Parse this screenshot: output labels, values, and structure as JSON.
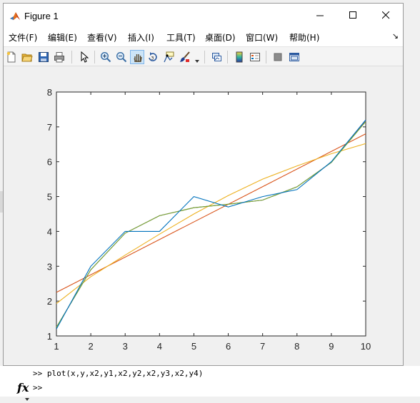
{
  "window": {
    "title": "Figure 1",
    "minimize_icon": "minimize-icon",
    "maximize_icon": "maximize-icon",
    "close_icon": "close-icon"
  },
  "menu": {
    "items": [
      "文件(F)",
      "编辑(E)",
      "查看(V)",
      "插入(I)",
      "工具(T)",
      "桌面(D)",
      "窗口(W)",
      "帮助(H)"
    ],
    "dock_arrow": "↘"
  },
  "toolbar": {
    "buttons": [
      "new-figure-icon",
      "open-file-icon",
      "save-icon",
      "print-icon",
      "pointer-icon",
      "zoom-in-icon",
      "zoom-out-icon",
      "pan-hand-icon",
      "rotate-3d-icon",
      "data-cursor-icon",
      "brush-icon",
      "link-plot-icon",
      "colorbar-icon",
      "legend-icon",
      "hide-tools-icon",
      "show-tools-icon"
    ],
    "active": "pan-hand-icon"
  },
  "colors": {
    "series": [
      "#0072BD",
      "#D95319",
      "#EDB120",
      "#7E2F8E",
      "#77AC30"
    ]
  },
  "chart_data": {
    "type": "line",
    "xlim": [
      1,
      10
    ],
    "ylim": [
      1,
      8
    ],
    "xticks": [
      "1",
      "2",
      "3",
      "4",
      "5",
      "6",
      "7",
      "8",
      "9",
      "10"
    ],
    "yticks": [
      "1",
      "2",
      "3",
      "4",
      "5",
      "6",
      "7",
      "8"
    ],
    "grid": false,
    "series": [
      {
        "x": [
          1,
          2,
          3,
          4,
          5,
          6,
          7,
          8,
          9,
          10
        ],
        "y": [
          1.2,
          3.0,
          4.0,
          4.0,
          5.0,
          4.7,
          5.0,
          5.2,
          6.0,
          7.2
        ]
      },
      {
        "x": [
          1,
          10
        ],
        "y": [
          2.25,
          6.8
        ]
      },
      {
        "x": [
          1,
          2,
          3,
          4,
          5,
          6,
          7,
          8,
          9,
          10
        ],
        "y": [
          1.93,
          2.7,
          3.32,
          3.92,
          4.5,
          5.03,
          5.5,
          5.88,
          6.23,
          6.52
        ]
      },
      {
        "x": [
          1,
          2,
          3,
          4,
          5,
          6,
          7,
          8,
          9,
          10
        ],
        "y": [
          1.25,
          2.9,
          3.95,
          4.45,
          4.68,
          4.78,
          4.9,
          5.28,
          5.98,
          7.18
        ]
      },
      {
        "x": [
          1,
          2,
          3,
          4,
          5,
          6,
          7,
          8,
          9,
          10
        ],
        "y": [
          1.25,
          2.9,
          3.95,
          4.45,
          4.68,
          4.78,
          4.9,
          5.28,
          5.98,
          7.15
        ]
      }
    ]
  },
  "command_window": {
    "line1": ">> plot(x,y,x2,y1,x2,y2,x2,y3,x2,y4)",
    "prompt": ">>",
    "fx_label": "fx"
  }
}
